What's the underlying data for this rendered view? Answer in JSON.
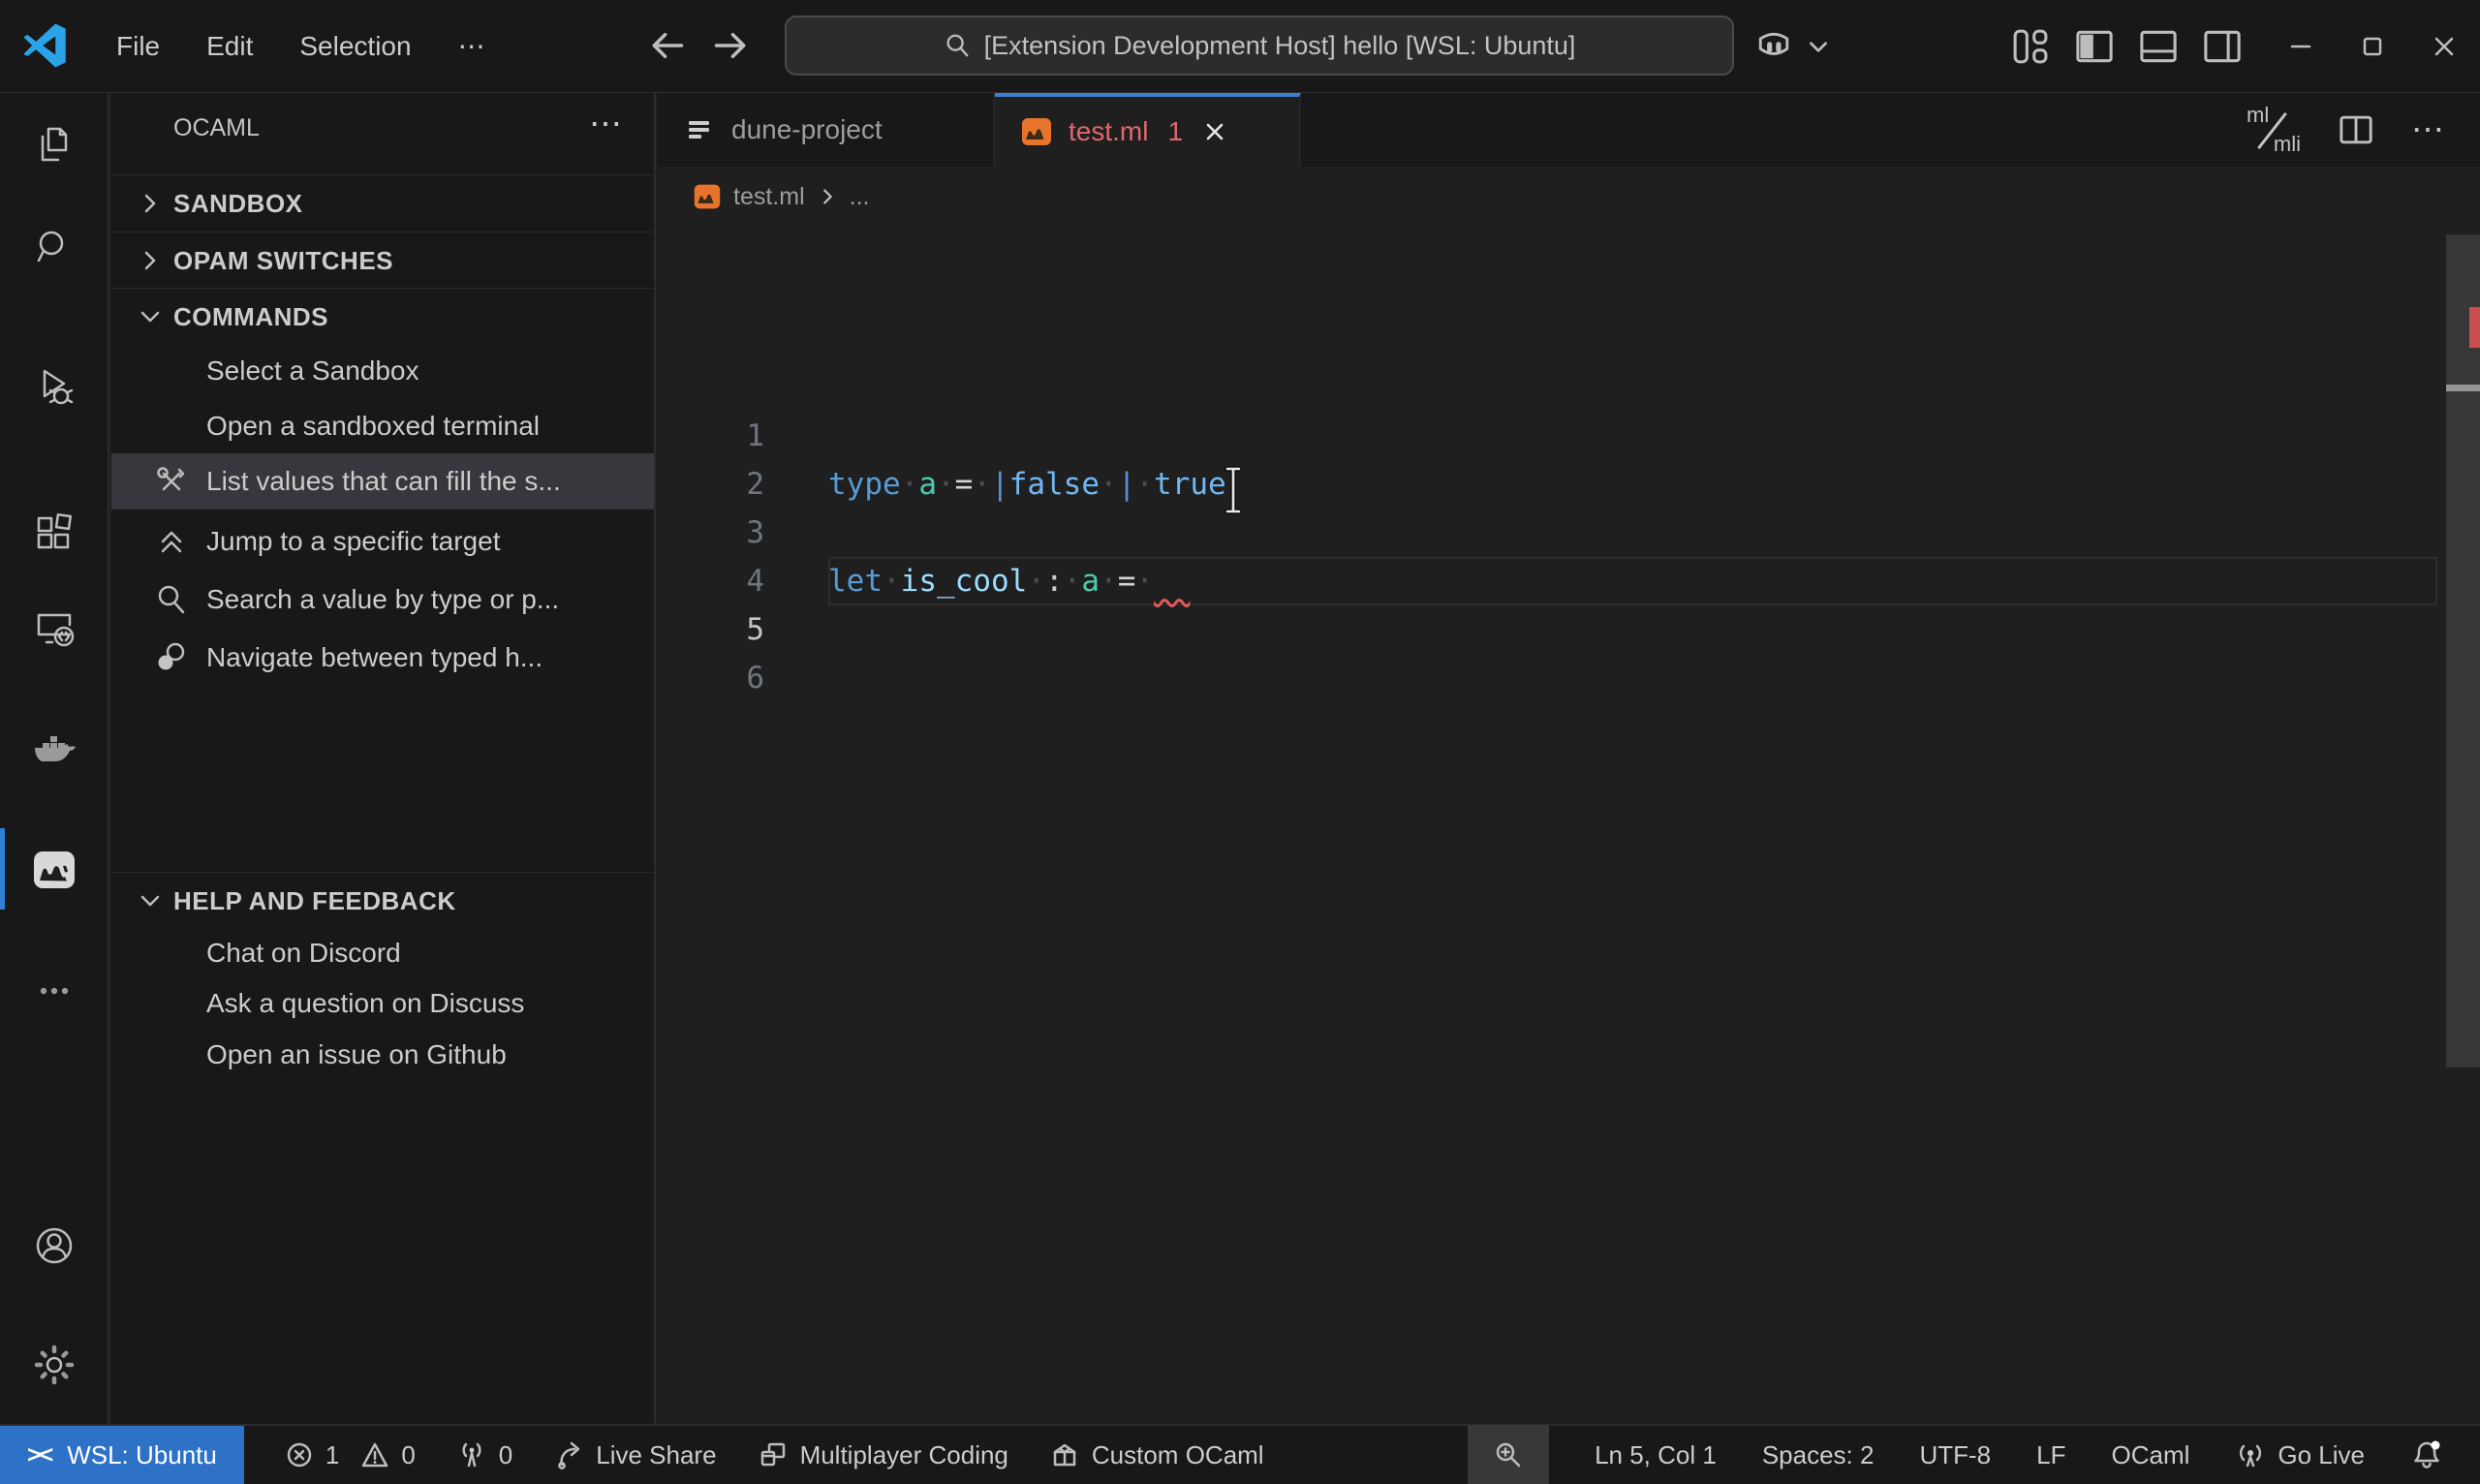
{
  "titlebar": {
    "menus": [
      "File",
      "Edit",
      "Selection",
      "⋯"
    ],
    "search": "[Extension Development Host] hello [WSL: Ubuntu]"
  },
  "activitybar": {
    "items": [
      "explorer",
      "search",
      "run-and-debug",
      "extensions",
      "remote-explorer",
      "docker",
      "ocaml",
      "more",
      "accounts",
      "settings"
    ],
    "active": "ocaml"
  },
  "sidebar": {
    "title": "OCAML",
    "more": "⋯",
    "sections": [
      {
        "label": "SANDBOX"
      },
      {
        "label": "OPAM SWITCHES"
      },
      {
        "label": "COMMANDS"
      }
    ],
    "commands": [
      {
        "label": "Select a Sandbox"
      },
      {
        "label": "Open a sandboxed terminal"
      },
      {
        "label": "List values that can fill the s..."
      },
      {
        "label": "Jump to a specific target"
      },
      {
        "label": "Search a value by type or p..."
      },
      {
        "label": "Navigate between typed h..."
      }
    ],
    "help_section": "HELP AND FEEDBACK",
    "help": [
      {
        "label": "Chat on Discord"
      },
      {
        "label": "Ask a question on Discuss"
      },
      {
        "label": "Open an issue on Github"
      }
    ]
  },
  "editor": {
    "tabs": [
      {
        "label": "dune-project"
      },
      {
        "label": "test.ml",
        "badge": "1"
      }
    ],
    "actions": {
      "mlmli_top": "ml",
      "mlmli_bottom": "mli",
      "more": "⋯"
    },
    "breadcrumb": {
      "file": "test.ml",
      "rest": "..."
    },
    "code": {
      "lines": [
        {
          "num": "1"
        },
        {
          "num": "2"
        },
        {
          "num": "3"
        },
        {
          "num": "4"
        },
        {
          "num": "5"
        },
        {
          "num": "6"
        }
      ],
      "tokens1": [
        {
          "t": "type"
        },
        {
          "t": "·"
        },
        {
          "t": "a"
        },
        {
          "t": "·"
        },
        {
          "t": "="
        },
        {
          "t": "·"
        },
        {
          "t": "|"
        },
        {
          "t": "false"
        },
        {
          "t": "·"
        },
        {
          "t": "|"
        },
        {
          "t": "·"
        },
        {
          "t": "true"
        }
      ],
      "tokens3": [
        {
          "t": "let"
        },
        {
          "t": "·"
        },
        {
          "t": "is_cool"
        },
        {
          "t": "·"
        },
        {
          "t": ":"
        },
        {
          "t": "·"
        },
        {
          "t": "a"
        },
        {
          "t": "·"
        },
        {
          "t": "="
        },
        {
          "t": "·"
        },
        {
          "t": "  "
        }
      ],
      "cursor_line": "5"
    }
  },
  "statusbar": {
    "remote": {
      "glyph": "><",
      "label": "WSL: Ubuntu"
    },
    "errors": "1",
    "warnings": "0",
    "ports": "0",
    "live_share": "Live Share",
    "multiplayer": "Multiplayer Coding",
    "custom_ocaml": "Custom OCaml",
    "cursor": "Ln 5, Col 1",
    "indent": "Spaces: 2",
    "encoding": "UTF-8",
    "eol": "LF",
    "language": "OCaml",
    "go_live": "Go Live"
  },
  "colors": {
    "accent_blue": "#2f81d7",
    "remote_blue": "#2e72c8",
    "error_red": "#c94f4f",
    "tab_error_text": "#e0696f",
    "ocaml_orange": "#e8742c",
    "panel_bg": "#181818",
    "editor_bg": "#1f1f1f"
  }
}
